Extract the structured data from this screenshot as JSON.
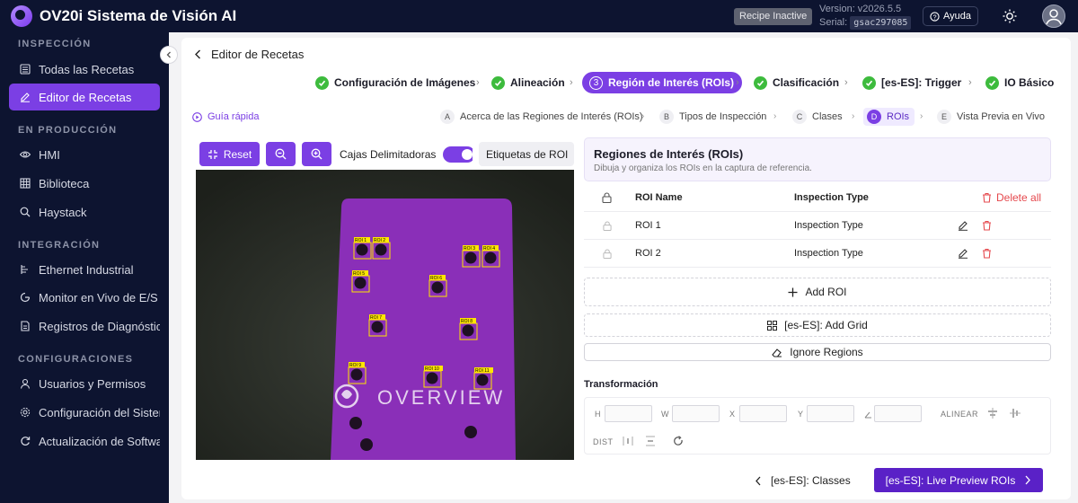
{
  "app": {
    "title": "OV20i Sistema de Visión AI",
    "recipe_status": "Recipe Inactive",
    "version_label": "Version: v2026.5.5",
    "serial_label": "Serial:",
    "serial_value": "gsac297085",
    "help_label": "Ayuda"
  },
  "sidebar": {
    "sections": [
      {
        "title": "INSPECCIÓN"
      },
      {
        "title": "EN PRODUCCIÓN"
      },
      {
        "title": "INTEGRACIÓN"
      },
      {
        "title": "CONFIGURACIONES"
      }
    ],
    "items": [
      {
        "label": "Todas las Recetas",
        "icon": "list-icon"
      },
      {
        "label": "Editor de Recetas",
        "icon": "edit-icon",
        "active": true
      },
      {
        "label": "HMI",
        "icon": "eye-icon"
      },
      {
        "label": "Biblioteca",
        "icon": "grid-icon"
      },
      {
        "label": "Haystack",
        "icon": "search-icon"
      },
      {
        "label": "Ethernet Industrial",
        "icon": "network-icon"
      },
      {
        "label": "Monitor en Vivo de E/S",
        "icon": "monitor-icon"
      },
      {
        "label": "Registros de Diagnóstico",
        "icon": "log-icon"
      },
      {
        "label": "Usuarios y Permisos",
        "icon": "user-icon"
      },
      {
        "label": "Configuración del Sistema",
        "icon": "gear-icon"
      },
      {
        "label": "Actualización de Software",
        "icon": "refresh-icon"
      }
    ]
  },
  "editor": {
    "back_title": "Editor de Recetas",
    "steps": [
      {
        "label": "Configuración de Imágenes",
        "state": "done"
      },
      {
        "label": "Alineación",
        "state": "done"
      },
      {
        "num": "3",
        "label": "Región de Interés (ROIs)",
        "state": "active"
      },
      {
        "label": "Clasificación",
        "state": "done"
      },
      {
        "label": "[es-ES]: Trigger",
        "state": "done"
      },
      {
        "label": "IO Básico",
        "state": "done"
      }
    ],
    "quick_guide": "Guía rápida",
    "substeps": [
      {
        "letter": "A",
        "label": "Acerca de las Regiones de Interés (ROIs)"
      },
      {
        "letter": "B",
        "label": "Tipos de Inspección"
      },
      {
        "letter": "C",
        "label": "Clases"
      },
      {
        "letter": "D",
        "label": "ROIs",
        "active": true
      },
      {
        "letter": "E",
        "label": "Vista Previa en Vivo"
      }
    ]
  },
  "toolbar": {
    "reset_label": "Reset",
    "bbox_toggle_label": "Cajas Delimitadoras",
    "roi_labels_toggle_label": "Etiquetas de ROI"
  },
  "canvas": {
    "board_text": "OVERVIEW",
    "rois": [
      "ROI 1",
      "ROI 2",
      "ROI 3",
      "ROI 4",
      "ROI 5",
      "ROI 6",
      "ROI 7",
      "ROI 8",
      "ROI 9",
      "ROI 10",
      "ROI 11"
    ],
    "accent": "#ffe600",
    "board_color": "#8a2fb8"
  },
  "roi_panel": {
    "title": "Regiones de Interés (ROIs)",
    "subtitle": "Dibuja y organiza los ROIs en la captura de referencia.",
    "columns": {
      "name": "ROI Name",
      "type": "Inspection Type",
      "delete_all": "Delete all"
    },
    "rows": [
      {
        "name": "ROI 1",
        "type": "Inspection Type"
      },
      {
        "name": "ROI 2",
        "type": "Inspection Type"
      }
    ],
    "add_roi": "Add ROI",
    "add_grid": "[es-ES]: Add Grid",
    "ignore_regions": "Ignore Regions"
  },
  "transform": {
    "title": "Transformación",
    "labels": {
      "h": "H",
      "w": "W",
      "x": "X",
      "y": "Y",
      "align": "ALINEAR",
      "dist": "DIST"
    }
  },
  "footer": {
    "back_label": "[es-ES]: Classes",
    "next_label": "[es-ES]: Live Preview ROIs"
  },
  "colors": {
    "accent": "#7b3fe4",
    "sidebar_bg": "#0d1430",
    "success": "#3dbb3d",
    "danger": "#e5484d"
  }
}
